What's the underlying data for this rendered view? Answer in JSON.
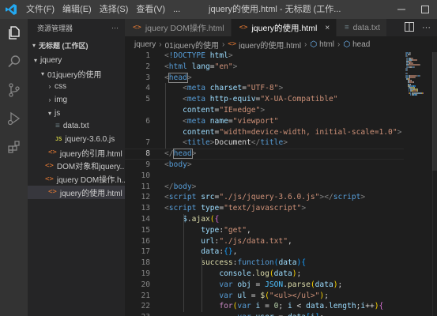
{
  "titlebar": {
    "menu": [
      "文件(F)",
      "编辑(E)",
      "选择(S)",
      "查看(V)",
      "..."
    ],
    "title": "jquery的使用.html - 无标题 (工作..."
  },
  "activity_bar": {
    "items": [
      "files-icon",
      "search-icon",
      "source-control-icon",
      "run-debug-icon",
      "extensions-icon"
    ]
  },
  "sidebar": {
    "header": "资源管理器",
    "header_more": "···",
    "section": "无标题 (工作区)",
    "tree": [
      {
        "label": "jquery",
        "kind": "folder",
        "depth": 0,
        "open": true
      },
      {
        "label": "01jquery的使用",
        "kind": "folder",
        "depth": 1,
        "open": true
      },
      {
        "label": "css",
        "kind": "folder",
        "depth": 2,
        "open": false
      },
      {
        "label": "img",
        "kind": "folder",
        "depth": 2,
        "open": false
      },
      {
        "label": "js",
        "kind": "folder",
        "depth": 2,
        "open": true
      },
      {
        "label": "data.txt",
        "kind": "txt",
        "depth": 3
      },
      {
        "label": "jquery-3.6.0.js",
        "kind": "js",
        "depth": 3
      },
      {
        "label": "jquery的引用.html",
        "kind": "html",
        "depth": 2
      },
      {
        "label": "DOM对象和jquery...",
        "kind": "html",
        "depth": 2
      },
      {
        "label": "jquery DOM操作.h...",
        "kind": "html",
        "depth": 2
      },
      {
        "label": "jquery的使用.html",
        "kind": "html",
        "depth": 2,
        "selected": true
      }
    ],
    "icon_glyphs": {
      "js": "JS",
      "html": "<>",
      "txt": "≡"
    }
  },
  "tabs": [
    {
      "label": "jquery DOM操作.html",
      "icon": "<>",
      "active": false,
      "kind": "html"
    },
    {
      "label": "jquery的使用.html",
      "icon": "<>",
      "active": true,
      "kind": "html",
      "close": "×"
    },
    {
      "label": "data.txt",
      "icon": "≡",
      "active": false,
      "kind": "txt"
    }
  ],
  "tab_actions": [
    "split-editor-icon",
    "more-actions-icon"
  ],
  "breadcrumb": {
    "items": [
      "jquery",
      "01jquery的使用",
      "jquery的使用.html",
      "html",
      "head"
    ],
    "sep": "›"
  },
  "editor": {
    "current_line": 8,
    "lines": [
      {
        "n": "1",
        "tokens": [
          [
            "tk-br",
            "<"
          ],
          [
            "tk-tag",
            "!DOCTYPE"
          ],
          [
            "tk-text",
            " "
          ],
          [
            "tk-attr",
            "html"
          ],
          [
            "tk-br",
            ">"
          ]
        ]
      },
      {
        "n": "2",
        "tokens": [
          [
            "tk-br",
            "<"
          ],
          [
            "tk-tag",
            "html"
          ],
          [
            "tk-text",
            " "
          ],
          [
            "tk-attr",
            "lang"
          ],
          [
            "tk-punc",
            "="
          ],
          [
            "tk-str",
            "\"en\""
          ],
          [
            "tk-br",
            ">"
          ]
        ]
      },
      {
        "n": "3",
        "tokens": [
          [
            "tk-br",
            "<"
          ],
          [
            "tk-tag matchbox",
            "head"
          ],
          [
            "tk-br",
            ">"
          ]
        ]
      },
      {
        "n": "4",
        "tokens": [
          [
            "tk-text",
            "    "
          ],
          [
            "tk-br",
            "<"
          ],
          [
            "tk-tag",
            "meta"
          ],
          [
            "tk-text",
            " "
          ],
          [
            "tk-attr",
            "charset"
          ],
          [
            "tk-punc",
            "="
          ],
          [
            "tk-str",
            "\"UTF-8\""
          ],
          [
            "tk-br",
            ">"
          ]
        ]
      },
      {
        "n": "5",
        "tokens": [
          [
            "tk-text",
            "    "
          ],
          [
            "tk-br",
            "<"
          ],
          [
            "tk-tag",
            "meta"
          ],
          [
            "tk-text",
            " "
          ],
          [
            "tk-attr",
            "http-equiv"
          ],
          [
            "tk-punc",
            "="
          ],
          [
            "tk-str",
            "\"X-UA-Compatible\""
          ]
        ]
      },
      {
        "n": "",
        "tokens": [
          [
            "tk-text",
            "    "
          ],
          [
            "tk-attr",
            "content"
          ],
          [
            "tk-punc",
            "="
          ],
          [
            "tk-str",
            "\"IE=edge\""
          ],
          [
            "tk-br",
            ">"
          ]
        ]
      },
      {
        "n": "6",
        "tokens": [
          [
            "tk-text",
            "    "
          ],
          [
            "tk-br",
            "<"
          ],
          [
            "tk-tag",
            "meta"
          ],
          [
            "tk-text",
            " "
          ],
          [
            "tk-attr",
            "name"
          ],
          [
            "tk-punc",
            "="
          ],
          [
            "tk-str",
            "\"viewport\""
          ]
        ]
      },
      {
        "n": "",
        "tokens": [
          [
            "tk-text",
            "    "
          ],
          [
            "tk-attr",
            "content"
          ],
          [
            "tk-punc",
            "="
          ],
          [
            "tk-str",
            "\"width=device-width, initial-scale=1.0\""
          ],
          [
            "tk-br",
            ">"
          ]
        ]
      },
      {
        "n": "7",
        "tokens": [
          [
            "tk-text",
            "    "
          ],
          [
            "tk-br",
            "<"
          ],
          [
            "tk-tag",
            "title"
          ],
          [
            "tk-br",
            ">"
          ],
          [
            "tk-text",
            "Document"
          ],
          [
            "tk-br",
            "</"
          ],
          [
            "tk-tag",
            "title"
          ],
          [
            "tk-br",
            ">"
          ]
        ]
      },
      {
        "n": "8",
        "tokens": [
          [
            "tk-br",
            "</"
          ],
          [
            "tk-tag matchbox",
            "head"
          ],
          [
            "tk-br",
            ">"
          ]
        ]
      },
      {
        "n": "9",
        "tokens": [
          [
            "tk-br",
            "<"
          ],
          [
            "tk-tag",
            "body"
          ],
          [
            "tk-br",
            ">"
          ]
        ]
      },
      {
        "n": "10",
        "tokens": []
      },
      {
        "n": "11",
        "tokens": [
          [
            "tk-br",
            "</"
          ],
          [
            "tk-tag",
            "body"
          ],
          [
            "tk-br",
            ">"
          ]
        ]
      },
      {
        "n": "12",
        "tokens": [
          [
            "tk-br",
            "<"
          ],
          [
            "tk-tag",
            "script"
          ],
          [
            "tk-text",
            " "
          ],
          [
            "tk-attr",
            "src"
          ],
          [
            "tk-punc",
            "="
          ],
          [
            "tk-str",
            "\"./js/jquery-3.6.0.js\""
          ],
          [
            "tk-br",
            ">"
          ],
          [
            "tk-br",
            "</"
          ],
          [
            "tk-tag",
            "script"
          ],
          [
            "tk-br",
            ">"
          ]
        ]
      },
      {
        "n": "13",
        "tokens": [
          [
            "tk-br",
            "<"
          ],
          [
            "tk-tag",
            "script"
          ],
          [
            "tk-text",
            " "
          ],
          [
            "tk-attr",
            "type"
          ],
          [
            "tk-punc",
            "="
          ],
          [
            "tk-str",
            "\"text/javascript\""
          ],
          [
            "tk-br",
            ">"
          ]
        ]
      },
      {
        "n": "14",
        "tokens": [
          [
            "tk-text",
            "    "
          ],
          [
            "tk-var",
            "$"
          ],
          [
            "tk-punc",
            "."
          ],
          [
            "tk-fn",
            "ajax"
          ],
          [
            "tk-brack",
            "("
          ],
          [
            "tk-brack2",
            "{"
          ]
        ]
      },
      {
        "n": "15",
        "tokens": [
          [
            "tk-text",
            "        "
          ],
          [
            "tk-var",
            "type"
          ],
          [
            "tk-punc",
            ":"
          ],
          [
            "tk-str",
            "\"get\""
          ],
          [
            "tk-punc",
            ","
          ]
        ]
      },
      {
        "n": "16",
        "tokens": [
          [
            "tk-text",
            "        "
          ],
          [
            "tk-var",
            "url"
          ],
          [
            "tk-punc",
            ":"
          ],
          [
            "tk-str",
            "\"./js/data.txt\""
          ],
          [
            "tk-punc",
            ","
          ]
        ]
      },
      {
        "n": "17",
        "tokens": [
          [
            "tk-text",
            "        "
          ],
          [
            "tk-var",
            "data"
          ],
          [
            "tk-punc",
            ":"
          ],
          [
            "tk-brack3",
            "{}"
          ],
          [
            "tk-punc",
            ","
          ]
        ]
      },
      {
        "n": "18",
        "tokens": [
          [
            "tk-text",
            "        "
          ],
          [
            "tk-fn",
            "success"
          ],
          [
            "tk-punc",
            ":"
          ],
          [
            "tk-kw",
            "function"
          ],
          [
            "tk-brack3",
            "("
          ],
          [
            "tk-var",
            "data"
          ],
          [
            "tk-brack3",
            ")"
          ],
          [
            "tk-brack3",
            "{"
          ]
        ]
      },
      {
        "n": "19",
        "tokens": [
          [
            "tk-text",
            "            "
          ],
          [
            "tk-var",
            "console"
          ],
          [
            "tk-punc",
            "."
          ],
          [
            "tk-fn",
            "log"
          ],
          [
            "tk-brack",
            "("
          ],
          [
            "tk-var",
            "data"
          ],
          [
            "tk-brack",
            ")"
          ],
          [
            "tk-punc",
            ";"
          ]
        ]
      },
      {
        "n": "20",
        "tokens": [
          [
            "tk-text",
            "            "
          ],
          [
            "tk-kw",
            "var"
          ],
          [
            "tk-text",
            " "
          ],
          [
            "tk-var",
            "obj"
          ],
          [
            "tk-punc",
            " = "
          ],
          [
            "tk-obj",
            "JSON"
          ],
          [
            "tk-punc",
            "."
          ],
          [
            "tk-fn",
            "parse"
          ],
          [
            "tk-brack",
            "("
          ],
          [
            "tk-var",
            "data"
          ],
          [
            "tk-brack",
            ")"
          ],
          [
            "tk-punc",
            ";"
          ]
        ]
      },
      {
        "n": "21",
        "tokens": [
          [
            "tk-text",
            "            "
          ],
          [
            "tk-kw",
            "var"
          ],
          [
            "tk-text",
            " "
          ],
          [
            "tk-var",
            "ul"
          ],
          [
            "tk-punc",
            " = "
          ],
          [
            "tk-fn",
            "$"
          ],
          [
            "tk-brack",
            "("
          ],
          [
            "tk-str",
            "\"<ul></ul>\""
          ],
          [
            "tk-brack",
            ")"
          ],
          [
            "tk-punc",
            ";"
          ]
        ]
      },
      {
        "n": "22",
        "tokens": [
          [
            "tk-text",
            "            "
          ],
          [
            "tk-ctl",
            "for"
          ],
          [
            "tk-brack",
            "("
          ],
          [
            "tk-kw",
            "var"
          ],
          [
            "tk-text",
            " "
          ],
          [
            "tk-var",
            "i"
          ],
          [
            "tk-punc",
            " = "
          ],
          [
            "tk-num",
            "0"
          ],
          [
            "tk-punc",
            "; "
          ],
          [
            "tk-var",
            "i"
          ],
          [
            "tk-punc",
            " < "
          ],
          [
            "tk-var",
            "data"
          ],
          [
            "tk-punc",
            "."
          ],
          [
            "tk-var",
            "length"
          ],
          [
            "tk-punc",
            ";"
          ],
          [
            "tk-var",
            "i"
          ],
          [
            "tk-punc",
            "++"
          ],
          [
            "tk-brack",
            ")"
          ],
          [
            "tk-brack2",
            "{"
          ]
        ]
      },
      {
        "n": "23",
        "tokens": [
          [
            "tk-text",
            "                "
          ],
          [
            "tk-kw",
            "var"
          ],
          [
            "tk-text",
            " "
          ],
          [
            "tk-var",
            "user"
          ],
          [
            "tk-punc",
            " = "
          ],
          [
            "tk-var",
            "data"
          ],
          [
            "tk-brack3",
            "["
          ],
          [
            "tk-var",
            "i"
          ],
          [
            "tk-brack3",
            "]"
          ],
          [
            "tk-punc",
            ";"
          ]
        ]
      }
    ]
  }
}
